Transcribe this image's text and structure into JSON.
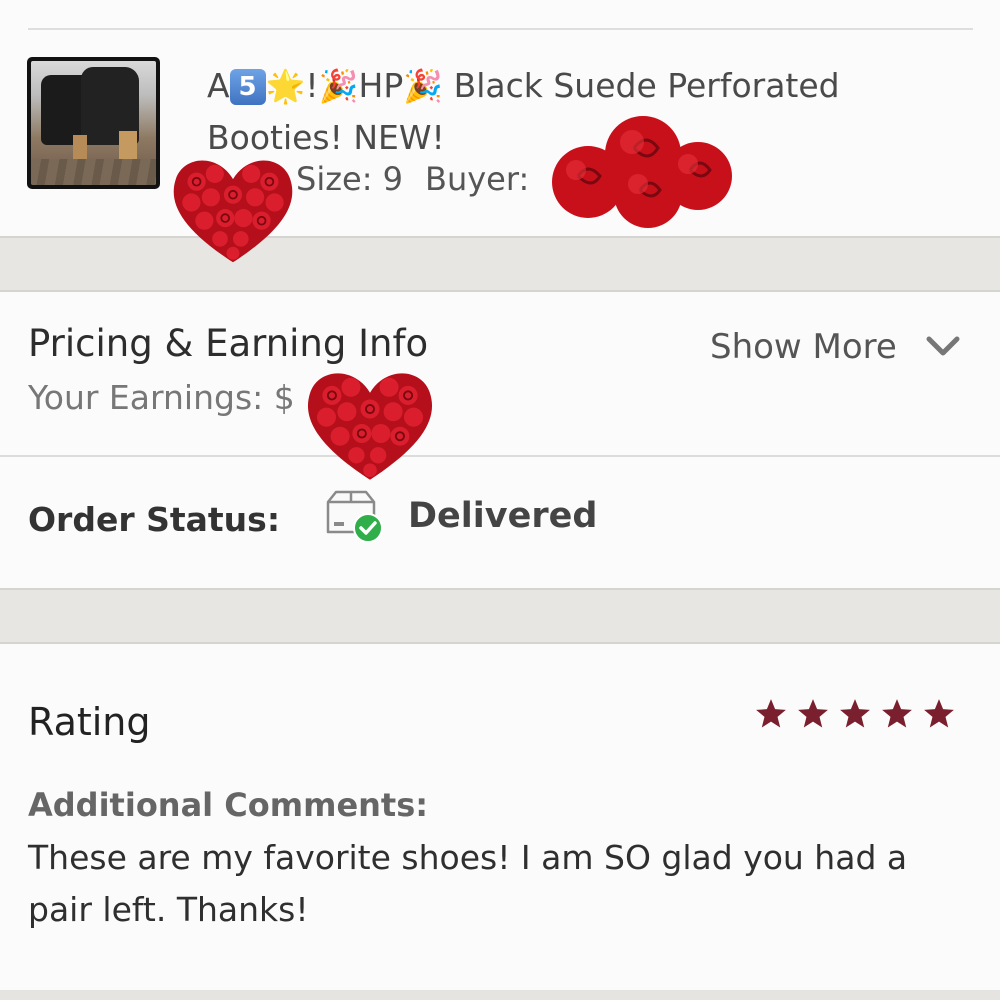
{
  "item": {
    "title_prefix": "A",
    "keycap_digit": "5",
    "star_emoji": "🌟",
    "exclaim": "!",
    "party_emoji": "🎉",
    "hp": "HP",
    "title_main": "Black Suede Perforated",
    "title_line2": "Booties! NEW!",
    "size_text": "Size: 9",
    "buyer_label": "Buyer:"
  },
  "pricing": {
    "heading": "Pricing & Earning Info",
    "show_more": "Show More",
    "earnings_label": "Your Earnings: $"
  },
  "order": {
    "label": "Order Status:",
    "value": "Delivered"
  },
  "rating": {
    "label": "Rating",
    "stars": 5,
    "star_color": "#7a1f2e",
    "comments_label": "Additional Comments:",
    "comments": "These are my favorite shoes! I am SO glad you had a pair left. Thanks!"
  },
  "colors": {
    "status_check": "#2fae4a",
    "sticker_red": "#c8101b"
  }
}
